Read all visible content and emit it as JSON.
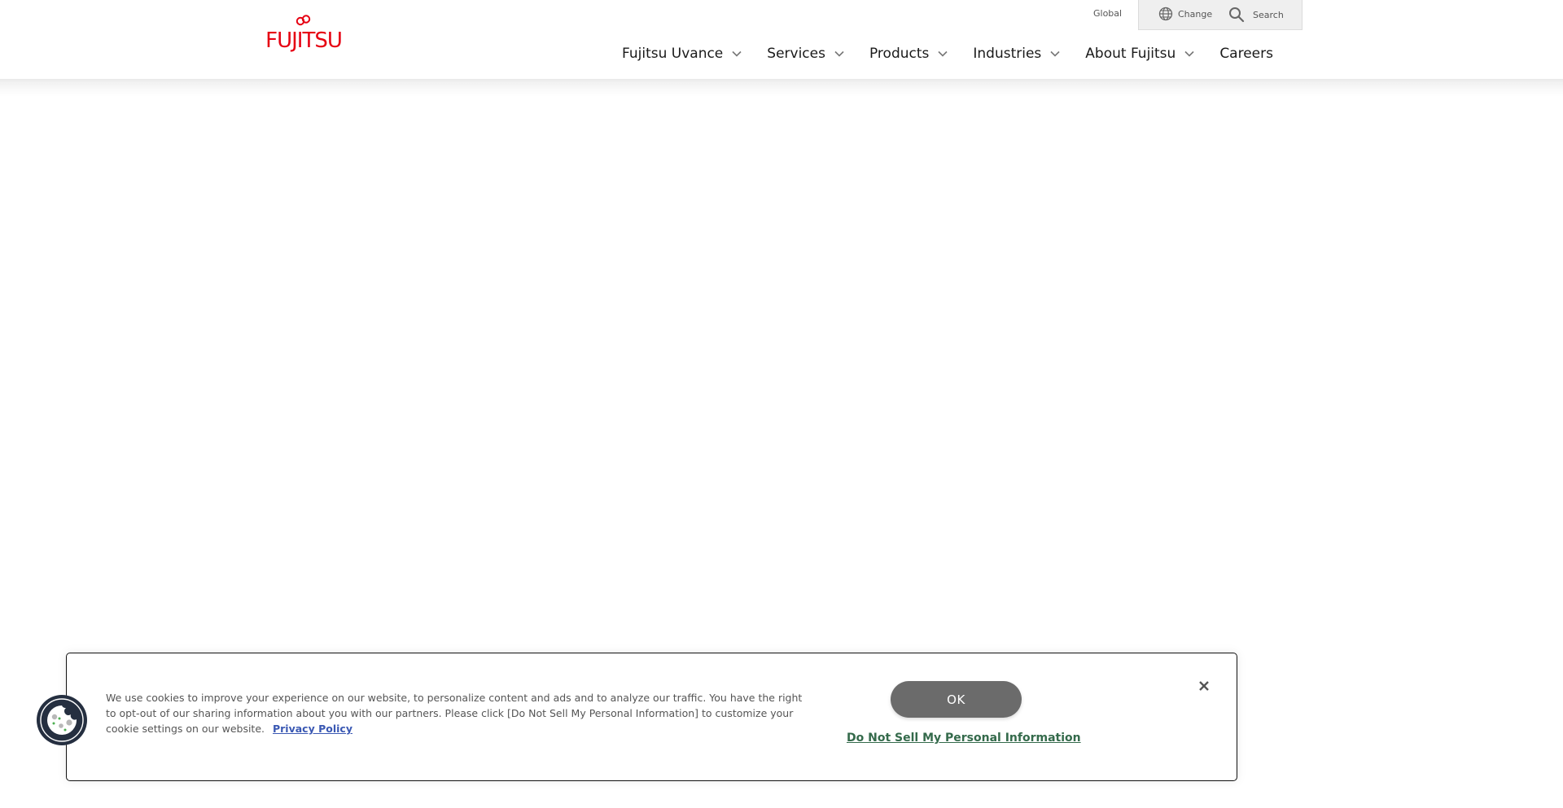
{
  "brand": {
    "logo_text": "FUJITSU",
    "color": "#e60012"
  },
  "utility_bar": {
    "region_label": "Global",
    "change_label": "Change",
    "search_label": "Search"
  },
  "nav": {
    "items": [
      {
        "label": "Fujitsu Uvance",
        "has_dropdown": true
      },
      {
        "label": "Services",
        "has_dropdown": true
      },
      {
        "label": "Products",
        "has_dropdown": true
      },
      {
        "label": "Industries",
        "has_dropdown": true
      },
      {
        "label": "About Fujitsu",
        "has_dropdown": true
      },
      {
        "label": "Careers",
        "has_dropdown": false
      }
    ]
  },
  "cookie_banner": {
    "message": "We use cookies to improve your experience on our website, to personalize content and ads and to analyze our traffic. You have the right to opt-out of our sharing information about you with our partners. Please click [Do Not Sell My Personal Information] to customize your cookie settings on our website.",
    "privacy_link_label": "Privacy Policy",
    "ok_label": "OK",
    "do_not_sell_label": "Do Not Sell My Personal Information",
    "close_icon": "close-icon",
    "badge_icon": "cookie-icon",
    "colors": {
      "ok_bg": "#6b6b6b",
      "do_not_sell": "#346a4b",
      "privacy_link": "#3a58b3",
      "badge_bg": "#252f40"
    }
  }
}
